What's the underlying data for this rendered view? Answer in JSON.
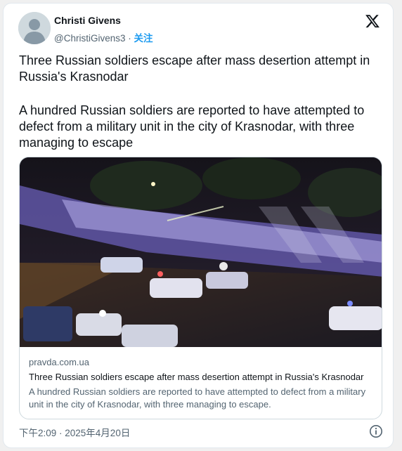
{
  "tweet": {
    "author_name": "Christi Givens",
    "handle": "@ChristiGivens3",
    "separator": " · ",
    "follow_label": "关注",
    "text_1": "Three Russian soldiers escape after mass desertion attempt in Russia's Krasnodar",
    "text_2": "A hundred Russian soldiers are reported to have attempted to defect from a military unit in the city of Krasnodar, with three managing to escape",
    "timestamp": "下午2:09 · 2025年4月20日"
  },
  "link_card": {
    "domain": "pravda.com.ua",
    "title": "Three Russian soldiers escape after mass desertion attempt in Russia's Krasnodar",
    "description": "A hundred Russian soldiers are reported to have attempted to defect from a military unit in the city of Krasnodar, with three managing to escape."
  },
  "colors": {
    "accent": "#1d9bf0",
    "text_primary": "#0f1419",
    "text_secondary": "#536471"
  },
  "icons": [
    "x-logo-icon",
    "info-icon",
    "default-avatar-icon"
  ]
}
